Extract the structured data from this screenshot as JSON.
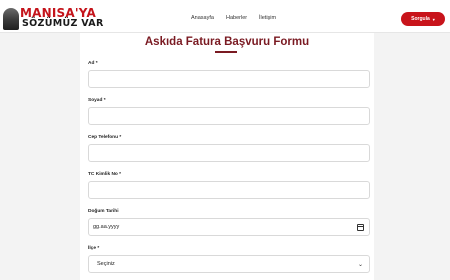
{
  "logo": {
    "line1": "MANISA'YA",
    "line2": "SÖZÜMÜZ VAR"
  },
  "nav": {
    "items": [
      "Anasayfa",
      "Haberler",
      "İletişim"
    ]
  },
  "cta": {
    "label": "Sorgula",
    "caret": "▾"
  },
  "form": {
    "title": "Askıda Fatura Başvuru Formu",
    "fields": {
      "ad": {
        "label": "Ad *",
        "value": ""
      },
      "soyad": {
        "label": "Soyad *",
        "value": ""
      },
      "cep": {
        "label": "Cep Telefonu *",
        "value": ""
      },
      "tc": {
        "label": "TC Kimlik No *",
        "value": ""
      },
      "dogum": {
        "label": "Doğum Tarihi",
        "value": "gg.aa.yyyy"
      },
      "ilce": {
        "label": "İlçe *",
        "value": "Seçiniz"
      }
    }
  },
  "colors": {
    "brand_red": "#c8141b",
    "title_maroon": "#7a1a22"
  }
}
